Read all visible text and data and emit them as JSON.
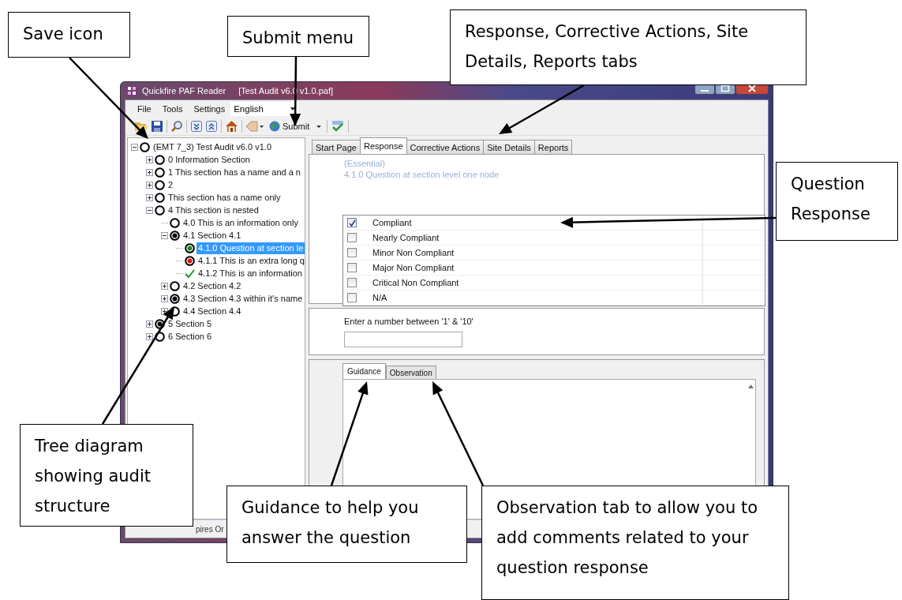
{
  "window": {
    "title": "Quickfire PAF Reader",
    "file": "[Test Audit v6.0 v1.0.paf]"
  },
  "menu": [
    "File",
    "Tools",
    "Settings"
  ],
  "language": {
    "value": "English"
  },
  "toolbar": {
    "submit": "Submit"
  },
  "tree": [
    {
      "label": "(EMT 7_3) Test Audit v6.0 v1.0",
      "kind": "empty",
      "expanded": true,
      "selected": false,
      "children": [
        {
          "label": "0 Information Section",
          "kind": "empty",
          "expanded": false,
          "selected": false
        },
        {
          "label": "1 This section has a name and a n",
          "kind": "empty",
          "expanded": false,
          "selected": false
        },
        {
          "label": "2",
          "kind": "empty",
          "expanded": false,
          "selected": false
        },
        {
          "label": "This section has a name only",
          "kind": "empty",
          "expanded": false,
          "selected": false
        },
        {
          "label": "4 This section is nested",
          "kind": "empty",
          "expanded": true,
          "selected": false,
          "children": [
            {
              "label": "4.0 This is an information only",
              "kind": "empty",
              "selected": false
            },
            {
              "label": "4.1 Section 4.1",
              "kind": "filled",
              "expanded": true,
              "selected": false,
              "children": [
                {
                  "label": "4.1.0 Question at section le",
                  "kind": "green",
                  "selected": true
                },
                {
                  "label": "4.1.1 This is an extra long q",
                  "kind": "red",
                  "selected": false
                },
                {
                  "label": "4.1.2 This is an information",
                  "kind": "check",
                  "selected": false
                }
              ]
            },
            {
              "label": "4.2 Section 4.2",
              "kind": "empty",
              "expanded": false,
              "selected": false
            },
            {
              "label": "4.3 Section 4.3 within it's name",
              "kind": "filled",
              "expanded": false,
              "selected": false
            },
            {
              "label": "4.4 Section 4.4",
              "kind": "empty",
              "expanded": false,
              "selected": false
            }
          ]
        },
        {
          "label": "5 Section 5",
          "kind": "filled",
          "expanded": false,
          "selected": false
        },
        {
          "label": "6 Section 6",
          "kind": "empty",
          "expanded": false,
          "selected": false
        }
      ]
    }
  ],
  "tabs": [
    {
      "label": "Start Page",
      "selected": false
    },
    {
      "label": "Response",
      "selected": true
    },
    {
      "label": "Corrective Actions",
      "selected": false
    },
    {
      "label": "Site Details",
      "selected": false
    },
    {
      "label": "Reports",
      "selected": false
    }
  ],
  "response": {
    "priority": "(Essential)",
    "question": "4.1.0 Question at section level one node",
    "options": [
      {
        "label": "Compliant",
        "checked": true
      },
      {
        "label": "Nearly Compliant",
        "checked": false
      },
      {
        "label": "Minor Non Compliant",
        "checked": false
      },
      {
        "label": "Major Non Compliant",
        "checked": false
      },
      {
        "label": "Critical Non Compliant",
        "checked": false
      },
      {
        "label": "N/A",
        "checked": false
      }
    ]
  },
  "number_question": {
    "prompt": "Enter a number between '1' & '10'"
  },
  "detail_tabs": [
    {
      "label": "Guidance",
      "selected": true
    },
    {
      "label": "Observation",
      "selected": false
    }
  ],
  "status_bar": {
    "text": "pires Or"
  },
  "callouts": [
    {
      "text": "Save icon"
    },
    {
      "text": "Submit menu"
    },
    {
      "text": "Response, Corrective Actions, Site Details, Reports tabs"
    },
    {
      "text": "Question Response"
    },
    {
      "text": "Tree diagram showing audit structure"
    },
    {
      "text": "Guidance to help you answer the question"
    },
    {
      "text": "Observation tab to allow you to add comments related to your question response"
    }
  ]
}
